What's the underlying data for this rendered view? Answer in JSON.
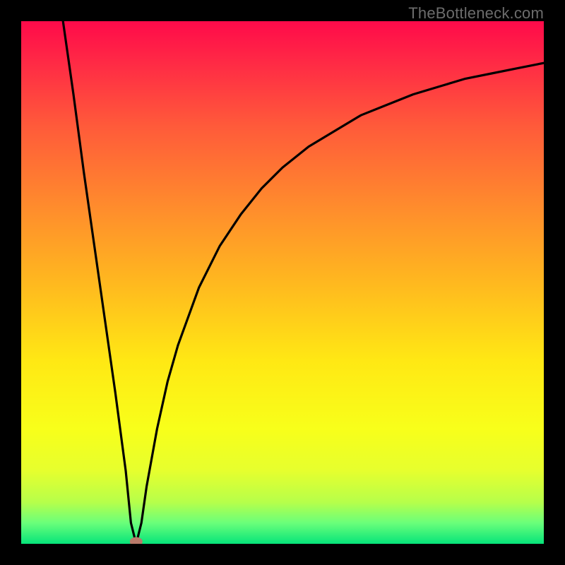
{
  "watermark": "TheBottleneck.com",
  "chart_data": {
    "type": "line",
    "title": "",
    "xlabel": "",
    "ylabel": "",
    "xlim": [
      0,
      100
    ],
    "ylim": [
      0,
      100
    ],
    "grid": false,
    "legend": false,
    "annotations": [
      {
        "type": "marker",
        "x": 22,
        "y": 0,
        "color": "#b97a6a",
        "shape": "ellipse"
      }
    ],
    "series": [
      {
        "name": "left-branch",
        "x": [
          8,
          10,
          12,
          14,
          16,
          18,
          20,
          21,
          22
        ],
        "values": [
          100,
          86,
          71,
          57,
          43,
          29,
          14,
          4,
          0
        ],
        "color": "#000000"
      },
      {
        "name": "right-branch",
        "x": [
          22,
          23,
          24,
          26,
          28,
          30,
          34,
          38,
          42,
          46,
          50,
          55,
          60,
          65,
          70,
          75,
          80,
          85,
          90,
          95,
          100
        ],
        "values": [
          0,
          4,
          11,
          22,
          31,
          38,
          49,
          57,
          63,
          68,
          72,
          76,
          79,
          82,
          84,
          86,
          87.5,
          89,
          90,
          91,
          92
        ],
        "color": "#000000"
      }
    ],
    "background_gradient": {
      "top": "#ff0a4a",
      "middle": "#ffe814",
      "bottom": "#06e47a"
    }
  }
}
